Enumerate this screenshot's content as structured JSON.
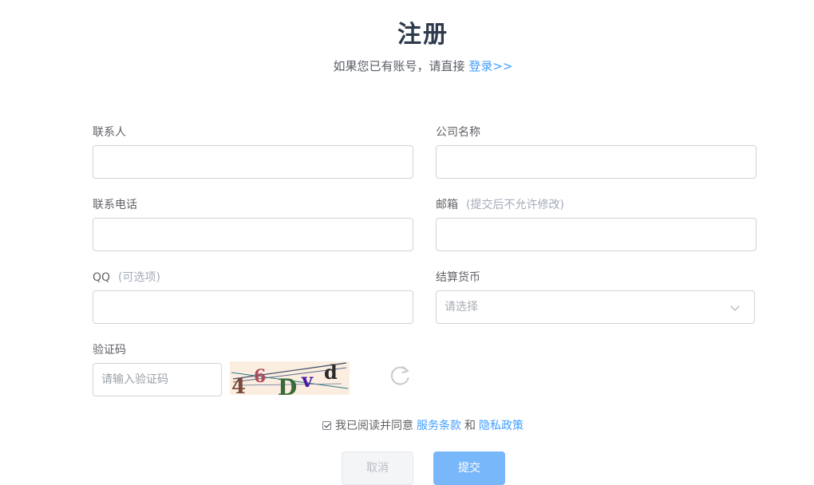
{
  "header": {
    "title": "注册",
    "subtitle_prefix": "如果您已有账号，请直接",
    "login_link": "登录>>"
  },
  "form": {
    "contact": {
      "label": "联系人",
      "value": ""
    },
    "company": {
      "label": "公司名称",
      "value": ""
    },
    "phone": {
      "label": "联系电话",
      "value": ""
    },
    "email": {
      "label": "邮箱",
      "hint": "(提交后不允许修改)",
      "value": ""
    },
    "qq": {
      "label": "QQ",
      "hint": "(可选项)",
      "value": ""
    },
    "currency": {
      "label": "结算货币",
      "placeholder": "请选择"
    },
    "captcha": {
      "label": "验证码",
      "placeholder": "请输入验证码",
      "image_text": "46Dvd"
    }
  },
  "agreement": {
    "checked": true,
    "text": "我已阅读并同意",
    "terms_link": "服务条款",
    "and": "和",
    "privacy_link": "隐私政策"
  },
  "buttons": {
    "cancel": "取消",
    "submit": "提交"
  },
  "colors": {
    "accent": "#409eff",
    "submit_bg": "#79b7fb",
    "title": "#2d3a4b"
  },
  "icons": {
    "refresh": "refresh-icon",
    "dropdown": "chevron-down-icon"
  }
}
